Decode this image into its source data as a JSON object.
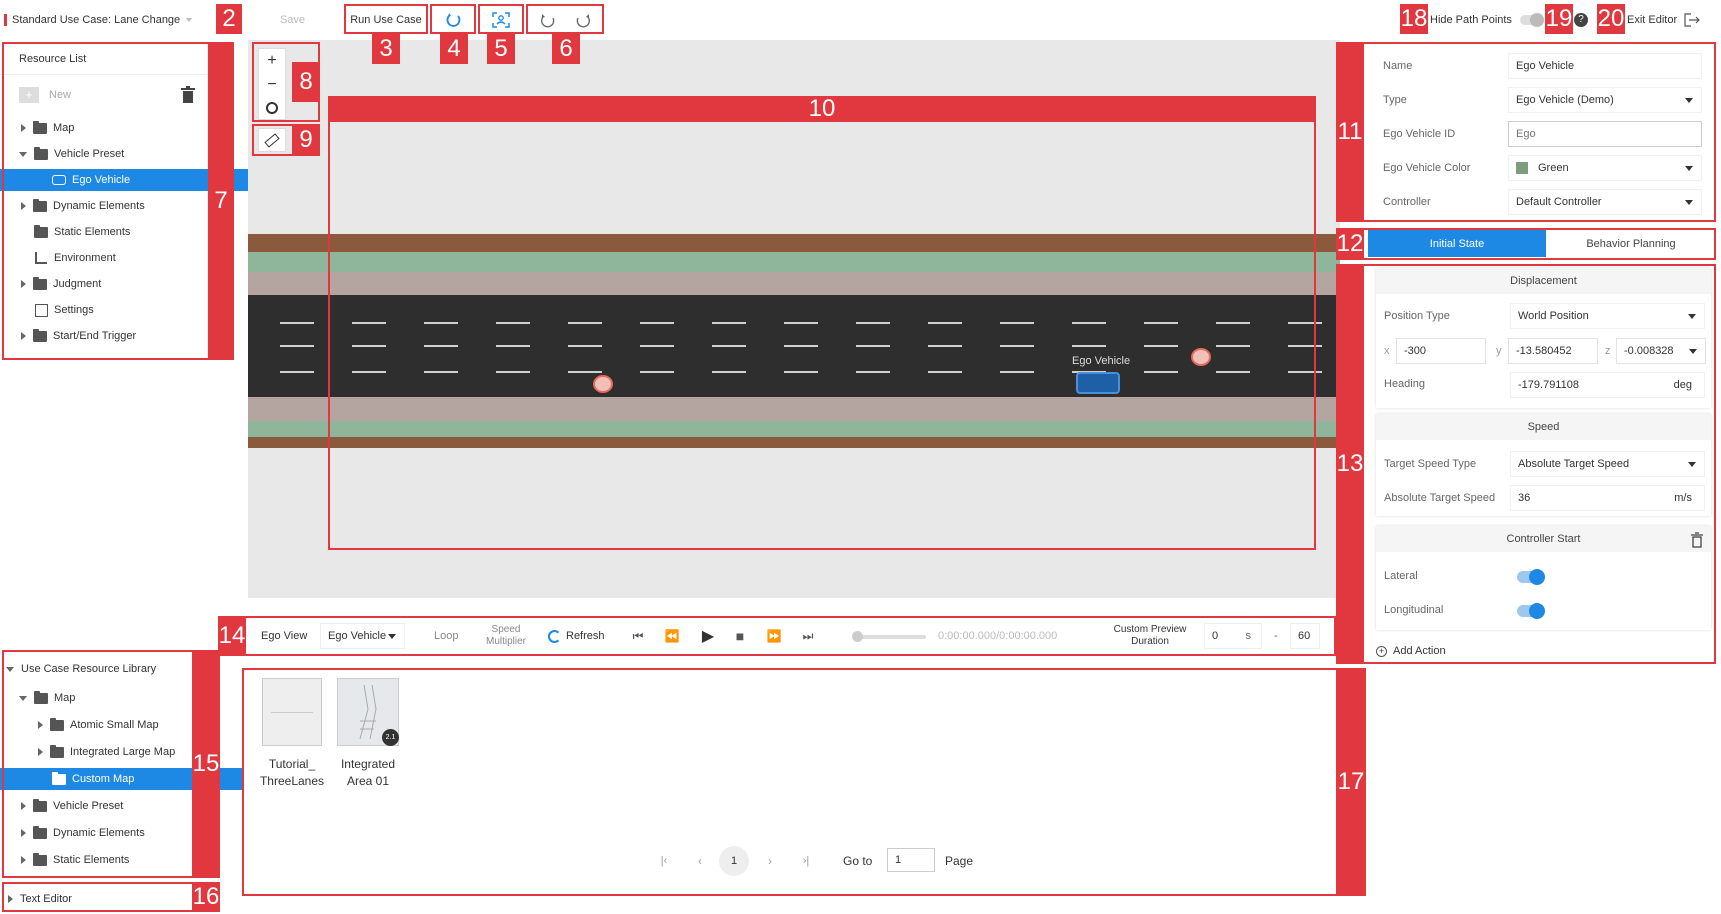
{
  "toolbar": {
    "use_case_title": "Standard Use Case: Lane Change",
    "save_label": "Save",
    "run_label": "Run Use Case",
    "hide_path_points_label": "Hide Path Points",
    "exit_editor_label": "Exit Editor"
  },
  "callouts": [
    "2",
    "3",
    "4",
    "5",
    "6",
    "7",
    "8",
    "9",
    "10",
    "11",
    "12",
    "13",
    "14",
    "15",
    "16",
    "17",
    "18",
    "19",
    "20"
  ],
  "resource_list": {
    "title": "Resource List",
    "new_label": "New",
    "items": [
      {
        "label": "Map"
      },
      {
        "label": "Vehicle Preset"
      },
      {
        "label": "Ego Vehicle"
      },
      {
        "label": "Dynamic Elements"
      },
      {
        "label": "Static Elements"
      },
      {
        "label": "Environment"
      },
      {
        "label": "Judgment"
      },
      {
        "label": "Settings"
      },
      {
        "label": "Start/End Trigger"
      }
    ]
  },
  "canvas": {
    "vehicle_label": "Ego Vehicle"
  },
  "properties": {
    "name_label": "Name",
    "name_value": "Ego Vehicle",
    "type_label": "Type",
    "type_value": "Ego Vehicle (Demo)",
    "id_label": "Ego Vehicle ID",
    "id_placeholder": "Ego",
    "color_label": "Ego Vehicle Color",
    "color_value": "Green",
    "color_swatch": "#7d9e7d",
    "controller_label": "Controller",
    "controller_value": "Default Controller"
  },
  "tabs": {
    "initial_state": "Initial State",
    "behavior_planning": "Behavior Planning"
  },
  "initial_state": {
    "displacement_title": "Displacement",
    "position_type_label": "Position Type",
    "position_type_value": "World Position",
    "x_label": "x",
    "x_value": "-300",
    "y_label": "y",
    "y_value": "-13.580452",
    "z_label": "z",
    "z_value": "-0.008328",
    "heading_label": "Heading",
    "heading_value": "-179.791108",
    "heading_unit": "deg",
    "speed_title": "Speed",
    "target_speed_type_label": "Target Speed Type",
    "target_speed_type_value": "Absolute Target Speed",
    "abs_speed_label": "Absolute Target Speed",
    "abs_speed_value": "36",
    "abs_speed_unit": "m/s",
    "controller_start_title": "Controller Start",
    "lateral_label": "Lateral",
    "longitudinal_label": "Longitudinal",
    "add_action_label": "Add Action"
  },
  "playback": {
    "view_label": "Ego View",
    "view_value": "Ego Vehicle",
    "loop_label": "Loop",
    "speed_multiplier_label": "Speed\nMultiplier",
    "refresh_label": "Refresh",
    "time_text": "0:00:00.000/0:00:00.000",
    "custom_duration_label": "Custom Preview\nDuration",
    "start_value": "0",
    "unit": "s",
    "separator": "-",
    "end_value": "60"
  },
  "library": {
    "title": "Use Case Resource Library",
    "items": [
      {
        "label": "Map"
      },
      {
        "label": "Atomic Small Map"
      },
      {
        "label": "Integrated Large Map"
      },
      {
        "label": "Custom Map"
      },
      {
        "label": "Vehicle Preset"
      },
      {
        "label": "Dynamic Elements"
      },
      {
        "label": "Static Elements"
      }
    ]
  },
  "text_editor": {
    "title": "Text Editor"
  },
  "maps": [
    {
      "name_line1": "Tutorial_",
      "name_line2": "ThreeLanes"
    },
    {
      "name_line1": "Integrated",
      "name_line2": "Area 01",
      "badge": "2.1"
    }
  ],
  "pagination": {
    "current_page": "1",
    "goto_label": "Go to",
    "goto_value": "1",
    "page_label": "Page"
  },
  "colors": {
    "accent": "#1e88e5",
    "annotation": "#e0383e",
    "road": "#2e2e2e",
    "median_green": "#8fb59a",
    "shoulder_brown": "#8b5a3c"
  }
}
